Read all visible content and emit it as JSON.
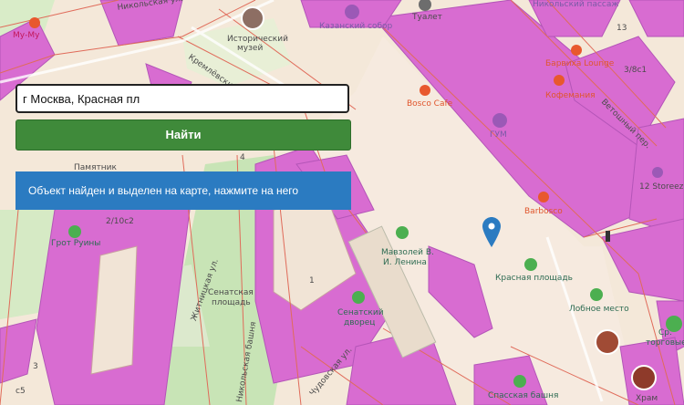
{
  "search": {
    "value": "г Москва, Красная пл"
  },
  "find_button": {
    "label": "Найти"
  },
  "notice": {
    "text": "Объект найден и выделен на карте, нажмите на него"
  },
  "map": {
    "labels": {
      "museum": [
        "Исторический",
        "музей"
      ],
      "kazan_cathedral": "Казанский собор",
      "toilet": "Туалет",
      "passage": "Никольский пассаж",
      "barvikha": "Барвиха Lounge",
      "coffeemania": "Кофемания",
      "bosco_cafe": "Bosco Cafe",
      "gum": "ГУМ",
      "barbosco": "Barbosco",
      "storeez": "12 Storeez",
      "red_square": "Красная площадь",
      "lobnoe_mesto": "Лобное место",
      "lenin_mausoleum": [
        "Мавзолей В.",
        "И. Ленина"
      ],
      "senate_palace": [
        "Сенатский",
        "дворец"
      ],
      "senate_square": [
        "Сенатская",
        "площадь"
      ],
      "grot_ruiny": "Грот Руины",
      "pamyatnik": "Памятник",
      "spasskaya_tower": "Спасская башня",
      "khram": "Храм",
      "torgovye": [
        "Ср.",
        "торговые"
      ],
      "kremlin_road": "Кремлёвский пр.",
      "zhitnitskaya": "Житницкая ул.",
      "chudovskaya": "Чудовская ул.",
      "nikolskaya": "Никольская ул.",
      "vetoshny": "Ветошный пер.",
      "nikolskaya_tower": "Никольская башня",
      "building_2_10c2": "2/10с2",
      "building_3_8c1": "3/8с1",
      "building_13": "13",
      "building_1": "1",
      "building_c5": "с5",
      "building_3": "3",
      "building_4": "4",
      "mumu": "Му-Му"
    }
  }
}
